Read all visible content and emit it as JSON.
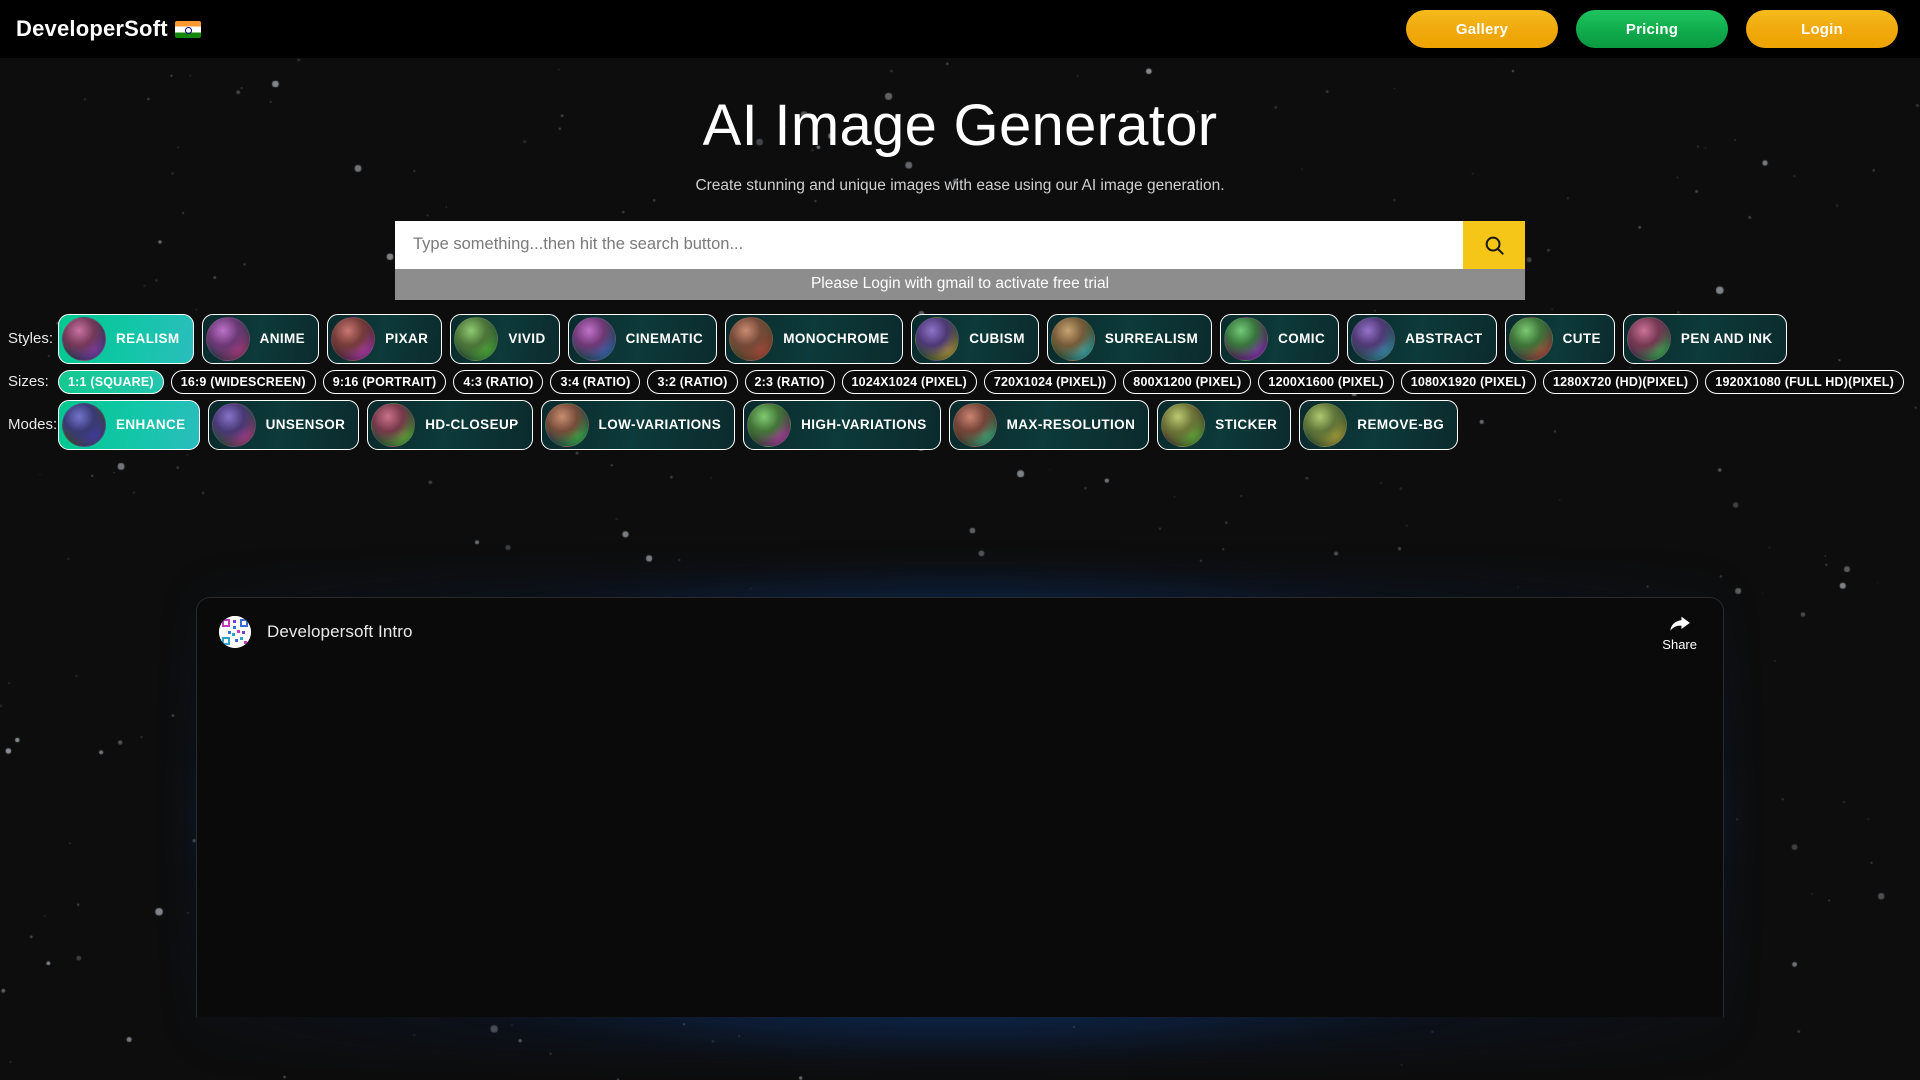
{
  "navbar": {
    "brand": "DeveloperSoft",
    "brand_flag_icon": "india-flag-icon",
    "buttons": [
      {
        "label": "Gallery",
        "color": "#f0a80c"
      },
      {
        "label": "Pricing",
        "color": "#0fa94a"
      },
      {
        "label": "Login",
        "color": "#f0a80c"
      }
    ]
  },
  "hero": {
    "title": "AI Image Generator",
    "subtitle": "Create stunning and unique images with ease using our AI image generation."
  },
  "search": {
    "placeholder": "Type something...then hit the search button...",
    "value": "",
    "button_icon": "search-icon",
    "button_color": "#f5c518",
    "notice": "Please Login with gmail to activate free trial",
    "notice_bg": "#8d8d8d"
  },
  "options": {
    "selected_color": "#12c98e",
    "styles": {
      "label": "Styles:",
      "selected": "REALISM",
      "items": [
        {
          "label": "REALISM"
        },
        {
          "label": "ANIME"
        },
        {
          "label": "PIXAR"
        },
        {
          "label": "VIVID"
        },
        {
          "label": "CINEMATIC"
        },
        {
          "label": "MONOCHROME"
        },
        {
          "label": "CUBISM"
        },
        {
          "label": "SURREALISM"
        },
        {
          "label": "COMIC"
        },
        {
          "label": "ABSTRACT"
        },
        {
          "label": "CUTE"
        },
        {
          "label": "PEN AND INK"
        }
      ]
    },
    "sizes": {
      "label": "Sizes:",
      "selected": "1:1 (SQUARE)",
      "items": [
        {
          "label": "1:1 (SQUARE)"
        },
        {
          "label": "16:9 (WIDESCREEN)"
        },
        {
          "label": "9:16 (PORTRAIT)"
        },
        {
          "label": "4:3 (RATIO)"
        },
        {
          "label": "3:4 (RATIO)"
        },
        {
          "label": "3:2 (RATIO)"
        },
        {
          "label": "2:3 (RATIO)"
        },
        {
          "label": "1024X1024 (PIXEL)"
        },
        {
          "label": "720X1024 (PIXEL))"
        },
        {
          "label": "800X1200 (PIXEL)"
        },
        {
          "label": "1200X1600 (PIXEL)"
        },
        {
          "label": "1080X1920 (PIXEL)"
        },
        {
          "label": "1280X720 (HD)(PIXEL)"
        },
        {
          "label": "1920X1080 (FULL HD)(PIXEL)"
        }
      ]
    },
    "modes": {
      "label": "Modes:",
      "selected": "ENHANCE",
      "items": [
        {
          "label": "ENHANCE"
        },
        {
          "label": "UNSENSOR"
        },
        {
          "label": "HD-CLOSEUP"
        },
        {
          "label": "LOW-VARIATIONS"
        },
        {
          "label": "HIGH-VARIATIONS"
        },
        {
          "label": "MAX-RESOLUTION"
        },
        {
          "label": "STICKER"
        },
        {
          "label": "REMOVE-BG"
        }
      ]
    }
  },
  "video": {
    "title": "Developersoft Intro",
    "avatar_icon": "qr-code-avatar-icon",
    "share_label": "Share",
    "share_icon": "share-arrow-icon",
    "glow_color": "#176ad6"
  }
}
